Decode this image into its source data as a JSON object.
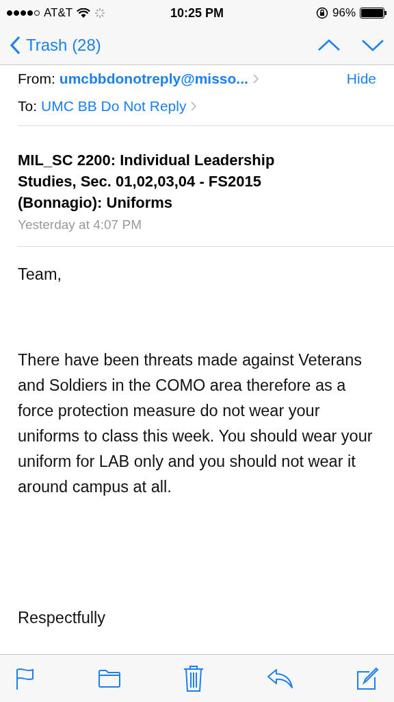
{
  "status_bar": {
    "carrier": "AT&T",
    "time": "10:25 PM",
    "battery": "96%"
  },
  "nav": {
    "back": "Trash (28)"
  },
  "header": {
    "from_label": "From:",
    "from": "umcbbdonotreply@misso...",
    "hide": "Hide",
    "to_label": "To:",
    "to": "UMC BB Do Not Reply",
    "subject": "MIL_SC 2200: Individual Leadership Studies, Sec. 01,02,03,04 - FS2015 (Bonnagio): Uniforms",
    "date": "Yesterday at 4:07 PM"
  },
  "body": {
    "greeting": "Team,",
    "paragraph": "There have been threats made against Veterans and Soldiers in the COMO area therefore as a force protection measure do not wear your uniforms to class this week. You should wear your uniform for LAB only and you should not wear it around campus at all.",
    "closing": "Respectfully"
  }
}
